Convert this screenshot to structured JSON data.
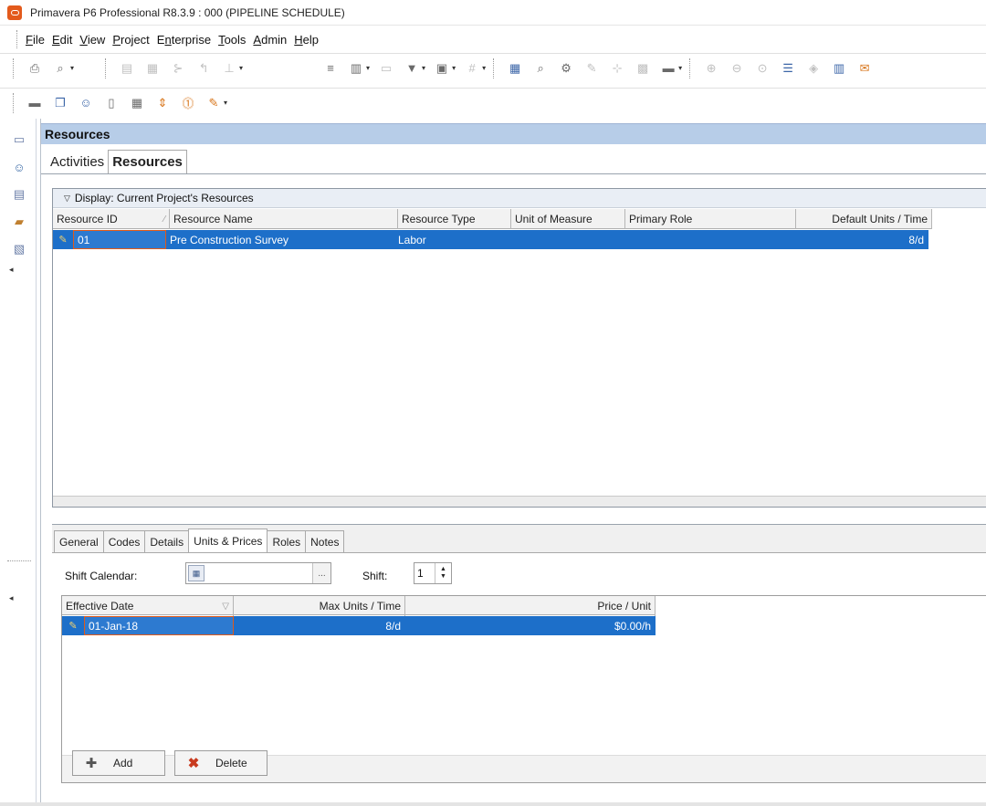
{
  "window": {
    "title": "Primavera P6 Professional R8.3.9 : 000 (PIPELINE SCHEDULE)",
    "app_icon": "primavera-icon"
  },
  "menu": [
    {
      "label": "File",
      "mnemonic": "F"
    },
    {
      "label": "Edit",
      "mnemonic": "E"
    },
    {
      "label": "View",
      "mnemonic": "V"
    },
    {
      "label": "Project",
      "mnemonic": "P"
    },
    {
      "label": "Enterprise",
      "mnemonic": "n"
    },
    {
      "label": "Tools",
      "mnemonic": "T"
    },
    {
      "label": "Admin",
      "mnemonic": "A"
    },
    {
      "label": "Help",
      "mnemonic": "H"
    }
  ],
  "panel": {
    "title": "Resources"
  },
  "view_tabs": {
    "activities": "Activities",
    "resources": "Resources"
  },
  "display": {
    "label": "Display: Current Project's Resources"
  },
  "resource_grid": {
    "columns": [
      "Resource ID",
      "Resource Name",
      "Resource Type",
      "Unit of Measure",
      "Primary Role",
      "Default Units / Time"
    ],
    "rows": [
      {
        "id": "01",
        "name": "Pre Construction Survey",
        "type": "Labor",
        "uom": "",
        "role": "",
        "units": "8/d"
      }
    ]
  },
  "detail_tabs": [
    "General",
    "Codes",
    "Details",
    "Units & Prices",
    "Roles",
    "Notes"
  ],
  "detail_active_tab": "Units & Prices",
  "units_prices": {
    "shift_calendar_label": "Shift Calendar:",
    "shift_calendar_button": "...",
    "shift_label": "Shift:",
    "shift_value": "1",
    "columns": [
      "Effective Date",
      "Max Units / Time",
      "Price / Unit"
    ],
    "rows": [
      {
        "date": "01-Jan-18",
        "max_units": "8/d",
        "price": "$0.00/h"
      }
    ],
    "add_label": "Add",
    "delete_label": "Delete"
  }
}
